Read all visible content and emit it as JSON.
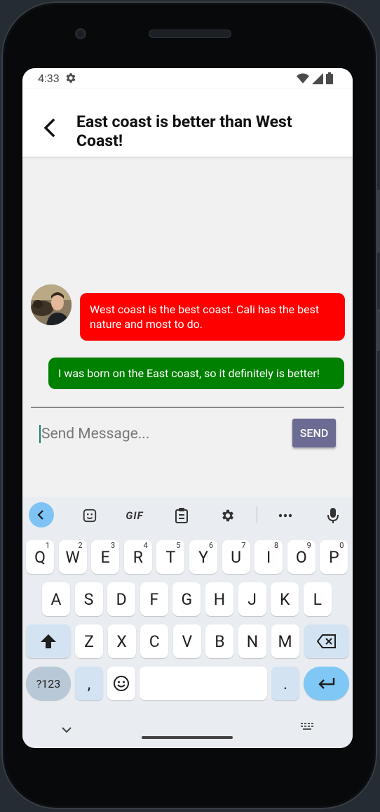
{
  "status_bar": {
    "time": "4:33",
    "icons": [
      "settings-icon",
      "wifi-icon",
      "signal-icon",
      "battery-icon"
    ]
  },
  "app_bar": {
    "title": "East coast is better than West Coast!",
    "back_icon": "arrow-back-icon"
  },
  "messages": [
    {
      "side": "left",
      "text": "West coast is the best coast. Cali has the best nature and most to do.",
      "color": "#ff0000",
      "has_avatar": true
    },
    {
      "side": "right",
      "text": "I was born on the East coast, so it definitely is better!",
      "color": "#008000",
      "has_avatar": false
    }
  ],
  "composer": {
    "placeholder": "Send Message...",
    "send_label": "SEND"
  },
  "keyboard": {
    "toolbar": [
      "back-icon",
      "sticker-icon",
      "GIF",
      "clipboard-icon",
      "gear-icon",
      "more-icon",
      "mic-icon"
    ],
    "gif_label": "GIF",
    "row1": [
      {
        "k": "Q",
        "h": "1"
      },
      {
        "k": "W",
        "h": "2"
      },
      {
        "k": "E",
        "h": "3"
      },
      {
        "k": "R",
        "h": "4"
      },
      {
        "k": "T",
        "h": "5"
      },
      {
        "k": "Y",
        "h": "6"
      },
      {
        "k": "U",
        "h": "7"
      },
      {
        "k": "I",
        "h": "8"
      },
      {
        "k": "O",
        "h": "9"
      },
      {
        "k": "P",
        "h": "0"
      }
    ],
    "row2": [
      "A",
      "S",
      "D",
      "F",
      "G",
      "H",
      "J",
      "K",
      "L"
    ],
    "row3": [
      "Z",
      "X",
      "C",
      "V",
      "B",
      "N",
      "M"
    ],
    "symbols_label": "?123",
    "comma": ",",
    "period": "."
  }
}
